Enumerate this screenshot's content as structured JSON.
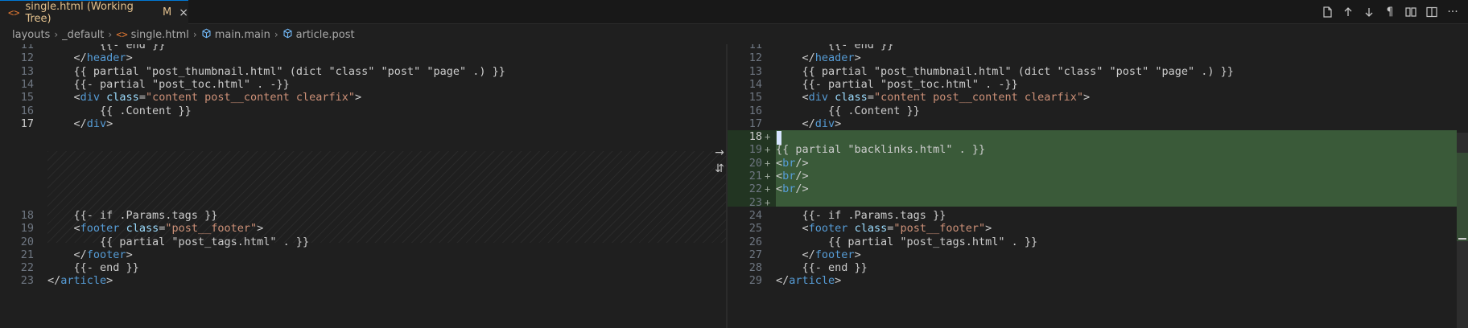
{
  "tab": {
    "icon": "<>",
    "title": "single.html (Working Tree)",
    "status": "M",
    "close": "×"
  },
  "breadcrumbs": [
    "layouts",
    "_default",
    "single.html",
    "main.main",
    "article.post"
  ],
  "toolbar": {
    "icons": [
      "open-file-icon",
      "arrow-up-icon",
      "arrow-down-icon",
      "pilcrow-icon",
      "book-icon",
      "split-editor-icon",
      "more-icon"
    ],
    "pilcrow": "¶",
    "more": "···"
  },
  "colors": {
    "insert_bg": "#3a5a39",
    "accent": "#0078d4",
    "modified": "#e2c08d"
  },
  "left_lines": [
    {
      "n": "11",
      "text": "        {{- end }}"
    },
    {
      "n": "12",
      "text": "    </header>"
    },
    {
      "n": "13",
      "text": "    {{ partial \"post_thumbnail.html\" (dict \"class\" \"post\" \"page\" .) }}"
    },
    {
      "n": "14",
      "text": "    {{- partial \"post_toc.html\" . -}}"
    },
    {
      "n": "15",
      "text": "    <div class=\"content post__content clearfix\">"
    },
    {
      "n": "16",
      "text": "        {{ .Content }}"
    },
    {
      "n": "17",
      "text": "    </div>"
    },
    {
      "n": "18",
      "text": "    {{- if .Params.tags }}"
    },
    {
      "n": "19",
      "text": "    <footer class=\"post__footer\">"
    },
    {
      "n": "20",
      "text": "        {{ partial \"post_tags.html\" . }}"
    },
    {
      "n": "21",
      "text": "    </footer>"
    },
    {
      "n": "22",
      "text": "    {{- end }}"
    },
    {
      "n": "23",
      "text": "</article>"
    }
  ],
  "right_lines": [
    {
      "n": "11",
      "text": "        {{- end }}"
    },
    {
      "n": "12",
      "text": "    </header>"
    },
    {
      "n": "13",
      "text": "    {{ partial \"post_thumbnail.html\" (dict \"class\" \"post\" \"page\" .) }}"
    },
    {
      "n": "14",
      "text": "    {{- partial \"post_toc.html\" . -}}"
    },
    {
      "n": "15",
      "text": "    <div class=\"content post__content clearfix\">"
    },
    {
      "n": "16",
      "text": "        {{ .Content }}"
    },
    {
      "n": "17",
      "text": "    </div>"
    },
    {
      "n": "18",
      "text": ""
    },
    {
      "n": "19",
      "text": "{{ partial \"backlinks.html\" . }}"
    },
    {
      "n": "20",
      "text": "<br/>"
    },
    {
      "n": "21",
      "text": "<br/>"
    },
    {
      "n": "22",
      "text": "<br/>"
    },
    {
      "n": "23",
      "text": ""
    },
    {
      "n": "24",
      "text": "    {{- if .Params.tags }}"
    },
    {
      "n": "25",
      "text": "    <footer class=\"post__footer\">"
    },
    {
      "n": "26",
      "text": "        {{ partial \"post_tags.html\" . }}"
    },
    {
      "n": "27",
      "text": "    </footer>"
    },
    {
      "n": "28",
      "text": "    {{- end }}"
    },
    {
      "n": "29",
      "text": "</article>"
    }
  ],
  "active_line": {
    "left": "17",
    "right": "18"
  },
  "inserted_range": [
    "18",
    "23"
  ],
  "gutter_marker": "+",
  "center_icons": {
    "arrow": "→",
    "revert": "⇵"
  }
}
